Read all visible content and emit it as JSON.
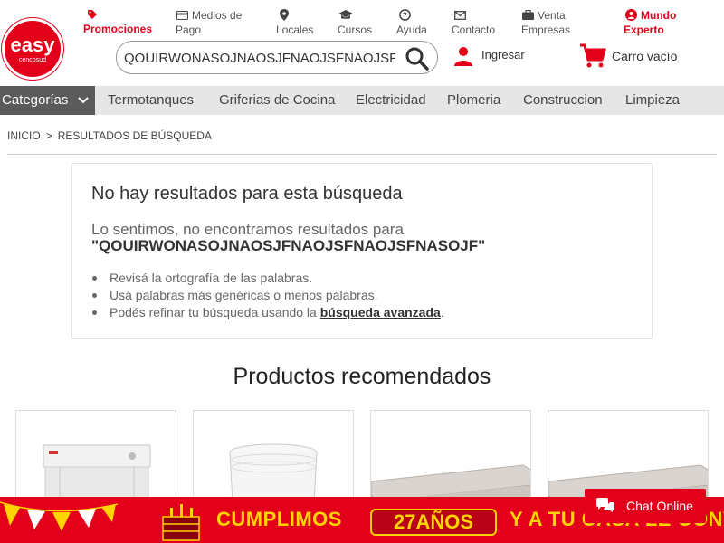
{
  "brand": {
    "logo_text": "easy",
    "logo_sub": "cencosud",
    "accent_color": "#e2001a",
    "secondary_color": "#ffd400"
  },
  "topnav": {
    "promociones": "Promociones",
    "medios_de_pago_1": "Medios de",
    "medios_de_pago_2": "Pago",
    "locales": "Locales",
    "cursos": "Cursos",
    "ayuda": "Ayuda",
    "contacto": "Contacto",
    "venta_empresas_1": "Venta",
    "venta_empresas_2": "Empresas",
    "mundo_experto_1": "Mundo",
    "mundo_experto_2": "Experto"
  },
  "search": {
    "value": "QOUIRWONASOJNAOSJFNAOJSFNAOJSFNASOJF",
    "placeholder": ""
  },
  "account": {
    "login_label": "Ingresar",
    "cart_label": "Carro vacío"
  },
  "categories": {
    "dropdown_label": "Categorías",
    "items": [
      "Termotanques",
      "Griferias de Cocina",
      "Electricidad",
      "Plomeria",
      "Construccion",
      "Limpieza"
    ]
  },
  "breadcrumb": {
    "home": "INICIO",
    "separator": ">",
    "current": "RESULTADOS DE BÚSQUEDA"
  },
  "no_results": {
    "title": "No hay resultados para esta búsqueda",
    "sorry": "Lo sentimos, no encontramos resultados para",
    "query": "\"QOUIRWONASOJNAOSJFNAOJSFNAOJSFNASOJF\"",
    "tip1": "Revisá la ortografía de las palabras.",
    "tip2": "Usá palabras más genéricas o menos palabras.",
    "tip3_prefix": "Podés refinar tu búsqueda usando la ",
    "tip3_link": "búsqueda avanzada",
    "tip3_suffix": "."
  },
  "recommended": {
    "title": "Productos recomendados"
  },
  "banner": {
    "text1": "CUMPLIMOS",
    "badge": "27AÑOS",
    "text2": "Y A TU CASA LE CONVIENE"
  },
  "chat": {
    "label": "Chat Online"
  }
}
